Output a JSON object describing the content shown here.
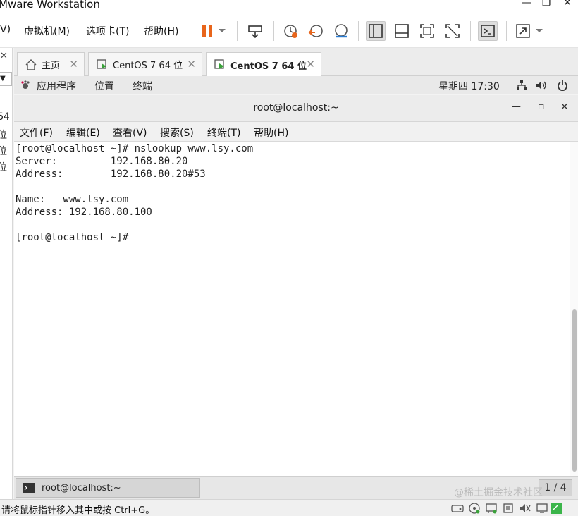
{
  "app": {
    "title": "Mware Workstation"
  },
  "window_controls": {
    "minimize": "—",
    "maximize": "❐",
    "close": "✕"
  },
  "menu": [
    "V)",
    "虚拟机(M)",
    "选项卡(T)",
    "帮助(H)"
  ],
  "left_panel": {
    "close": "✕",
    "dropdown": "▼",
    "items": [
      "64",
      "位",
      "位",
      "位"
    ]
  },
  "tabs": [
    {
      "label": "主页",
      "icon": "home-icon"
    },
    {
      "label": "CentOS 7 64 位",
      "icon": "vm-icon"
    },
    {
      "label": "CentOS 7 64 位",
      "icon": "vm-icon",
      "active": true
    }
  ],
  "tab_close": "✕",
  "gnome_bar": {
    "applications": "应用程序",
    "places": "位置",
    "terminal": "终端",
    "clock": "星期四 17:30"
  },
  "terminal": {
    "title": "root@localhost:~",
    "controls": {
      "minimize": "—",
      "maximize": "▫",
      "close": "✕"
    },
    "menu": [
      "文件(F)",
      "编辑(E)",
      "查看(V)",
      "搜索(S)",
      "终端(T)",
      "帮助(H)"
    ],
    "lines": [
      "[root@localhost ~]# nslookup www.lsy.com",
      "Server:         192.168.80.20",
      "Address:        192.168.80.20#53",
      "",
      "Name:   www.lsy.com",
      "Address: 192.168.80.100",
      "",
      "[root@localhost ~]# "
    ]
  },
  "taskbar": {
    "item": "root@localhost:~",
    "pager": "1 / 4"
  },
  "watermark": "@稀土掘金技术社区",
  "status": {
    "hint": "请将鼠标指针移入其中或按 Ctrl+G。"
  },
  "colors": {
    "pause": "#e8651b",
    "snapshot": "#e8651b",
    "vm_green": "#3aa13a"
  }
}
